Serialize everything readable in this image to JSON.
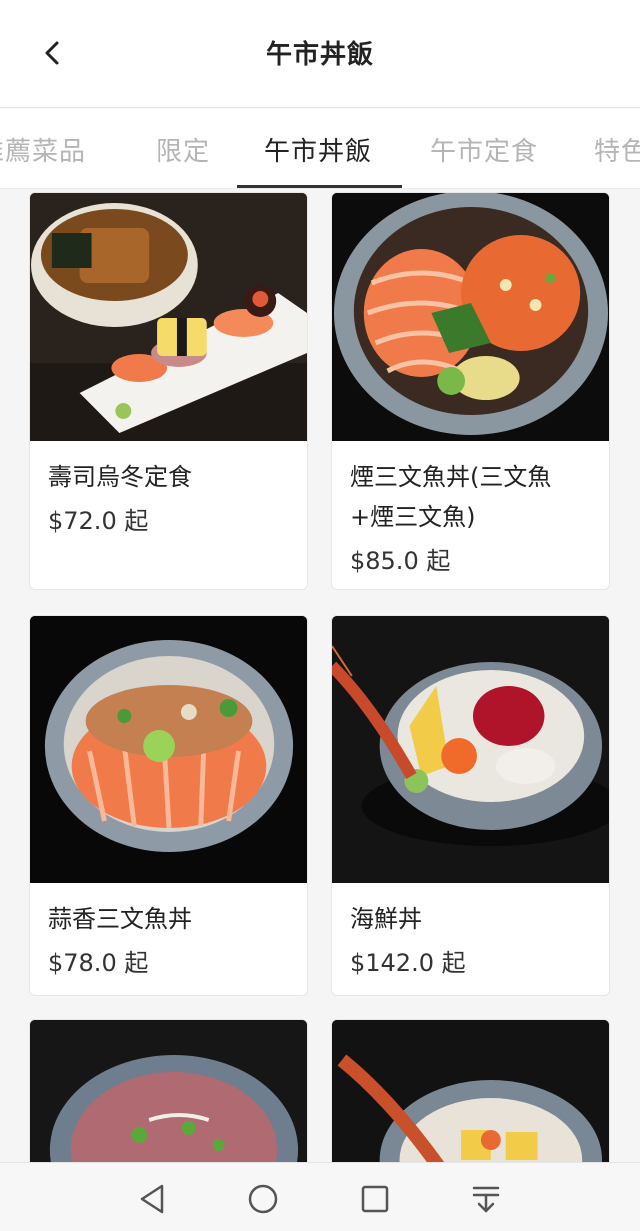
{
  "header": {
    "title": "午市丼飯",
    "back_icon": "chevron-left-icon"
  },
  "tabs": [
    {
      "label": "推薦菜品",
      "active": false
    },
    {
      "label": "限定",
      "active": false
    },
    {
      "label": "午市丼飯",
      "active": true
    },
    {
      "label": "午市定食",
      "active": false
    },
    {
      "label": "特色",
      "active": false
    }
  ],
  "products": [
    {
      "name": "壽司烏冬定食",
      "price": "$72.0 起",
      "image": "sushi-udon-set"
    },
    {
      "name": "煙三文魚丼(三文魚+煙三文魚)",
      "price": "$85.0 起",
      "image": "smoked-salmon-don"
    },
    {
      "name": "蒜香三文魚丼",
      "price": "$78.0 起",
      "image": "garlic-salmon-don"
    },
    {
      "name": "海鮮丼",
      "price": "$142.0 起",
      "image": "seafood-don"
    },
    {
      "name": "",
      "price": "",
      "image": "beef-don"
    },
    {
      "name": "",
      "price": "",
      "image": "prawn-don"
    }
  ],
  "navbar": {
    "icons": [
      "back-triangle-icon",
      "home-circle-icon",
      "recents-square-icon",
      "menu-down-icon"
    ]
  },
  "colors": {
    "active_tab": "#222222",
    "inactive_tab": "#b5b5b5",
    "page_background": "#f5f5f5",
    "card_background": "#ffffff"
  }
}
